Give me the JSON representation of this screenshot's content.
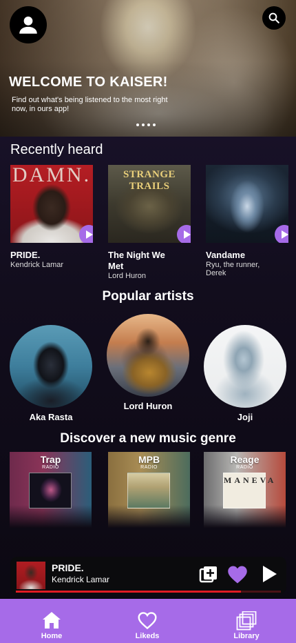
{
  "hero": {
    "title": "WELCOME TO KAISER!",
    "subtitle": "Find out what's being listened to the most right now, in ours app!",
    "slides_count": 4
  },
  "sections": {
    "recently_heard": "Recently heard",
    "popular_artists": "Popular artists",
    "discover_genre": "Discover a new music genre"
  },
  "recent": [
    {
      "title": "PRIDE.",
      "artist": "Kendrick Lamar",
      "cover_text": "DAMN."
    },
    {
      "title": "The Night We Met",
      "artist": "Lord Huron",
      "cover_text": "STRANGE TRAILS"
    },
    {
      "title": "Vandame",
      "artist": "Ryu, the runner, Derek",
      "cover_text": ""
    }
  ],
  "artists": [
    {
      "name": "Aka Rasta"
    },
    {
      "name": "Lord Huron"
    },
    {
      "name": "Joji"
    }
  ],
  "genres": [
    {
      "name": "Trap",
      "sub": "RADIO"
    },
    {
      "name": "MPB",
      "sub": "RADIO"
    },
    {
      "name": "Reage",
      "sub": "RADIO",
      "cover_text": "MANEVA"
    }
  ],
  "player": {
    "title": "PRIDE.",
    "artist": "Kendrick Lamar",
    "progress": 0.85
  },
  "nav": {
    "items": [
      {
        "label": "Home",
        "icon": "home-icon"
      },
      {
        "label": "Likeds",
        "icon": "heart-icon"
      },
      {
        "label": "Library",
        "icon": "library-icon"
      }
    ]
  },
  "colors": {
    "accent": "#a66be8",
    "progress": "#e01b24",
    "background": "#120d1d"
  }
}
